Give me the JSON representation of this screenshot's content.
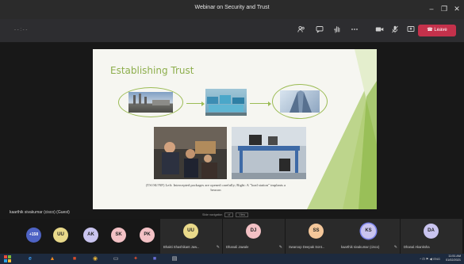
{
  "window": {
    "title": "Webinar on Security and Trust",
    "minimize_glyph": "–",
    "maximize_glyph": "❐",
    "close_glyph": "✕"
  },
  "call_bar": {
    "timer": "- - : - -",
    "leave_label": "Leave",
    "icons": [
      "people-icon",
      "chat-icon",
      "raise-hand-icon",
      "more-icon",
      "camera-icon",
      "mic-icon",
      "share-icon"
    ]
  },
  "slide": {
    "title": "Establishing Trust",
    "caption": "(TS//SI//NF) Left: Intercepted packages are opened carefully; Right: A \"load station\" implants a beacon"
  },
  "presenter": {
    "name": "kaarthik sivakumar (cisco) (Guest)"
  },
  "slide_footer": {
    "text": "Slide navigation",
    "chip1": "of",
    "chip2": "View"
  },
  "roster": {
    "overflow": "+158",
    "small_avatars": [
      {
        "initials": "UU",
        "color": "#e9d98a"
      },
      {
        "initials": "AK",
        "color": "#c9c4ef"
      },
      {
        "initials": "SK",
        "color": "#f3c1c5"
      },
      {
        "initials": "PK",
        "color": "#f3c1c5"
      }
    ],
    "tiles": [
      {
        "initials": "UU",
        "name": "Bhakti Shashikant Jaw...",
        "color": "#e9d98a"
      },
      {
        "initials": "DJ",
        "name": "Dhanali Jawale",
        "color": "#f3c1c5"
      },
      {
        "initials": "SS",
        "name": "Swaroop Deepak Sont...",
        "color": "#f4c79a"
      },
      {
        "initials": "KS",
        "name": "kaarthik sivakumar (cisco)",
        "color": "#c9c4ef"
      },
      {
        "initials": "DA",
        "name": "Dhanal Akanksha",
        "color": "#c9c4ef"
      }
    ]
  },
  "taskbar": {
    "time": "11:51 AM",
    "date": "01/02/2021",
    "tray": "^  ⊡  ⚑  ◀ᵎ  ENG"
  },
  "colors": {
    "accent_green": "#8dae4c",
    "leave_red": "#c4314b"
  }
}
